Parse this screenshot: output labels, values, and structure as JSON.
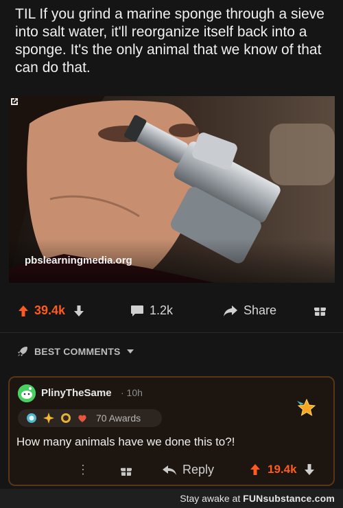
{
  "post": {
    "title": "TIL If you grind a marine sponge through a sieve into salt water, it'll reorganize itself back into a sponge. It's the only animal that we know of that can do that.",
    "link_domain": "pbslearningmedia.org"
  },
  "actions": {
    "upvotes": "39.4k",
    "comments": "1.2k",
    "share_label": "Share"
  },
  "sort": {
    "label": "BEST COMMENTS"
  },
  "comment": {
    "username": "PlinyTheSame",
    "time": "· 10h",
    "awards_label": "70 Awards",
    "body": "How many animals have we done this to?!",
    "more_label": "⋮",
    "reply_label": "Reply",
    "votes": "19.4k"
  },
  "watermark": {
    "prefix": "Stay awake at ",
    "brand": "FUNsubstance.com"
  },
  "colors": {
    "accent": "#ff5a1f",
    "background": "#151515",
    "comment_border": "#5a3516"
  }
}
